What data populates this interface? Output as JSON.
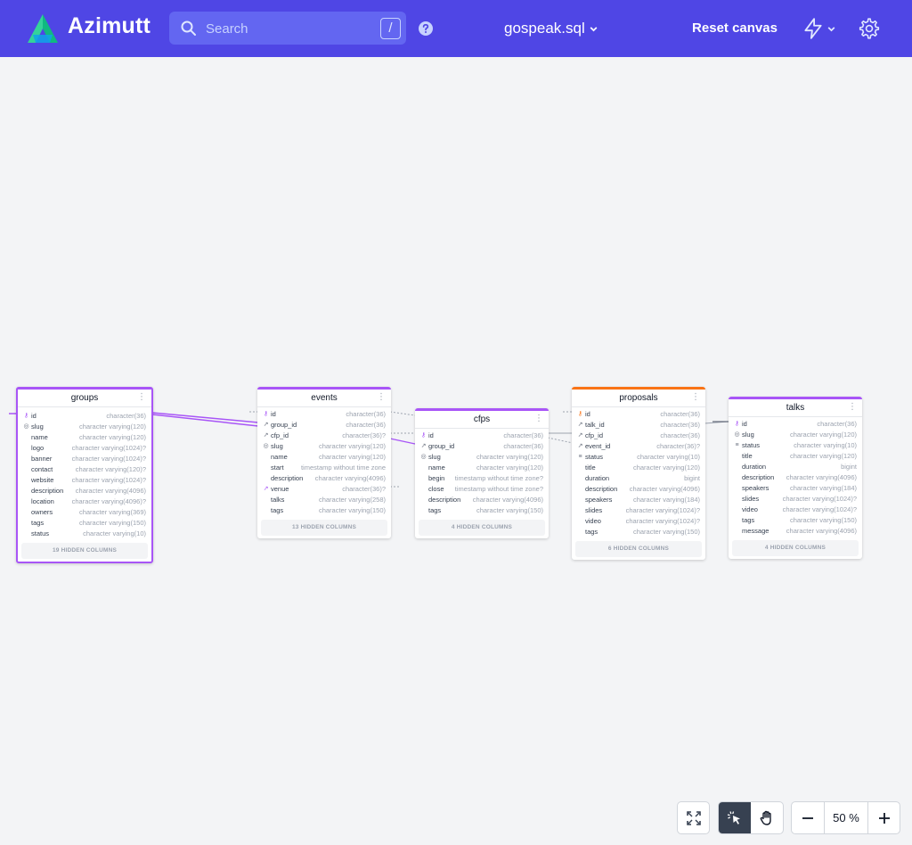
{
  "app": {
    "name": "Azimutt"
  },
  "search": {
    "placeholder": "Search",
    "shortcut": "/"
  },
  "project": {
    "name": "gospeak.sql"
  },
  "header": {
    "reset_label": "Reset canvas"
  },
  "zoom": {
    "value": "50 %"
  },
  "colors": {
    "nav": "#4f46e5",
    "accent": "#a855f7",
    "orange": "#f97316"
  },
  "tables": [
    {
      "name": "groups",
      "color": "purple",
      "selected": true,
      "columns": [
        {
          "name": "id",
          "type": "character(36)",
          "icon": "key-icon"
        },
        {
          "name": "slug",
          "type": "character varying(120)",
          "icon": "fingerprint-icon"
        },
        {
          "name": "name",
          "type": "character varying(120)",
          "icon": ""
        },
        {
          "name": "logo",
          "type": "character varying(1024)?",
          "icon": ""
        },
        {
          "name": "banner",
          "type": "character varying(1024)?",
          "icon": ""
        },
        {
          "name": "contact",
          "type": "character varying(120)?",
          "icon": ""
        },
        {
          "name": "website",
          "type": "character varying(1024)?",
          "icon": ""
        },
        {
          "name": "description",
          "type": "character varying(4096)",
          "icon": ""
        },
        {
          "name": "location",
          "type": "character varying(4096)?",
          "icon": ""
        },
        {
          "name": "owners",
          "type": "character varying(369)",
          "icon": ""
        },
        {
          "name": "tags",
          "type": "character varying(150)",
          "icon": ""
        },
        {
          "name": "status",
          "type": "character varying(10)",
          "icon": ""
        }
      ],
      "hidden": "19 HIDDEN COLUMNS"
    },
    {
      "name": "events",
      "color": "purple",
      "selected": false,
      "columns": [
        {
          "name": "id",
          "type": "character(36)",
          "icon": "key-icon"
        },
        {
          "name": "group_id",
          "type": "character(36)",
          "icon": "link-icon"
        },
        {
          "name": "cfp_id",
          "type": "character(36)?",
          "icon": "link-icon"
        },
        {
          "name": "slug",
          "type": "character varying(120)",
          "icon": "fingerprint-icon"
        },
        {
          "name": "name",
          "type": "character varying(120)",
          "icon": ""
        },
        {
          "name": "start",
          "type": "timestamp without time zone",
          "icon": ""
        },
        {
          "name": "description",
          "type": "character varying(4096)",
          "icon": ""
        },
        {
          "name": "venue",
          "type": "character(36)?",
          "icon": "link-icon"
        },
        {
          "name": "talks",
          "type": "character varying(258)",
          "icon": ""
        },
        {
          "name": "tags",
          "type": "character varying(150)",
          "icon": ""
        }
      ],
      "hidden": "13 HIDDEN COLUMNS"
    },
    {
      "name": "cfps",
      "color": "purple",
      "selected": false,
      "columns": [
        {
          "name": "id",
          "type": "character(36)",
          "icon": "key-icon"
        },
        {
          "name": "group_id",
          "type": "character(36)",
          "icon": "link-icon"
        },
        {
          "name": "slug",
          "type": "character varying(120)",
          "icon": "fingerprint-icon"
        },
        {
          "name": "name",
          "type": "character varying(120)",
          "icon": ""
        },
        {
          "name": "begin",
          "type": "timestamp without time zone?",
          "icon": ""
        },
        {
          "name": "close",
          "type": "timestamp without time zone?",
          "icon": ""
        },
        {
          "name": "description",
          "type": "character varying(4096)",
          "icon": ""
        },
        {
          "name": "tags",
          "type": "character varying(150)",
          "icon": ""
        }
      ],
      "hidden": "4 HIDDEN COLUMNS"
    },
    {
      "name": "proposals",
      "color": "orange",
      "selected": false,
      "columns": [
        {
          "name": "id",
          "type": "character(36)",
          "icon": "key-icon"
        },
        {
          "name": "talk_id",
          "type": "character(36)",
          "icon": "link-icon"
        },
        {
          "name": "cfp_id",
          "type": "character(36)",
          "icon": "link-icon"
        },
        {
          "name": "event_id",
          "type": "character(36)?",
          "icon": "link-icon"
        },
        {
          "name": "status",
          "type": "character varying(10)",
          "icon": "list-icon"
        },
        {
          "name": "title",
          "type": "character varying(120)",
          "icon": ""
        },
        {
          "name": "duration",
          "type": "bigint",
          "icon": ""
        },
        {
          "name": "description",
          "type": "character varying(4096)",
          "icon": ""
        },
        {
          "name": "speakers",
          "type": "character varying(184)",
          "icon": ""
        },
        {
          "name": "slides",
          "type": "character varying(1024)?",
          "icon": ""
        },
        {
          "name": "video",
          "type": "character varying(1024)?",
          "icon": ""
        },
        {
          "name": "tags",
          "type": "character varying(150)",
          "icon": ""
        }
      ],
      "hidden": "6 HIDDEN COLUMNS"
    },
    {
      "name": "talks",
      "color": "purple",
      "selected": false,
      "columns": [
        {
          "name": "id",
          "type": "character(36)",
          "icon": "key-icon"
        },
        {
          "name": "slug",
          "type": "character varying(120)",
          "icon": "fingerprint-icon"
        },
        {
          "name": "status",
          "type": "character varying(10)",
          "icon": "list-icon"
        },
        {
          "name": "title",
          "type": "character varying(120)",
          "icon": ""
        },
        {
          "name": "duration",
          "type": "bigint",
          "icon": ""
        },
        {
          "name": "description",
          "type": "character varying(4096)",
          "icon": ""
        },
        {
          "name": "speakers",
          "type": "character varying(184)",
          "icon": ""
        },
        {
          "name": "slides",
          "type": "character varying(1024)?",
          "icon": ""
        },
        {
          "name": "video",
          "type": "character varying(1024)?",
          "icon": ""
        },
        {
          "name": "tags",
          "type": "character varying(150)",
          "icon": ""
        },
        {
          "name": "message",
          "type": "character varying(4096)",
          "icon": ""
        }
      ],
      "hidden": "4 HIDDEN COLUMNS"
    }
  ]
}
